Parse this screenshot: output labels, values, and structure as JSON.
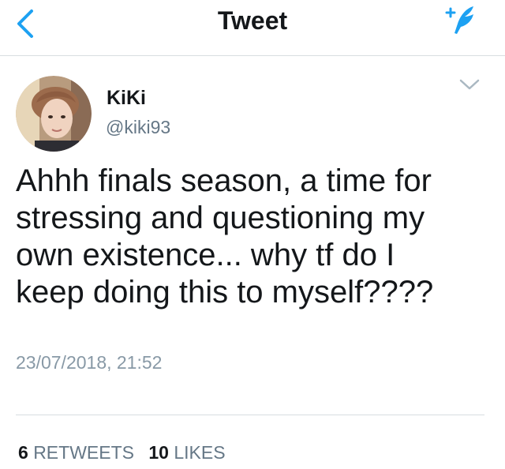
{
  "header": {
    "title": "Tweet",
    "back_icon": "chevron-left-icon",
    "compose_icon": "compose-tweet-icon",
    "accent_color": "#1da1f2"
  },
  "tweet": {
    "author_name": "KiKi",
    "author_handle": "@kiki93",
    "avatar_icon": "avatar-photo",
    "menu_icon": "chevron-down-icon",
    "text_lines": [
      "Ahhh finals season, a time for",
      "stressing and questioning my",
      "own existence... why tf do I",
      "keep doing this to myself????"
    ],
    "timestamp": "23/07/2018, 21:52",
    "retweets_count": "6",
    "retweets_label": "RETWEETS",
    "likes_count": "10",
    "likes_label": "LIKES"
  }
}
